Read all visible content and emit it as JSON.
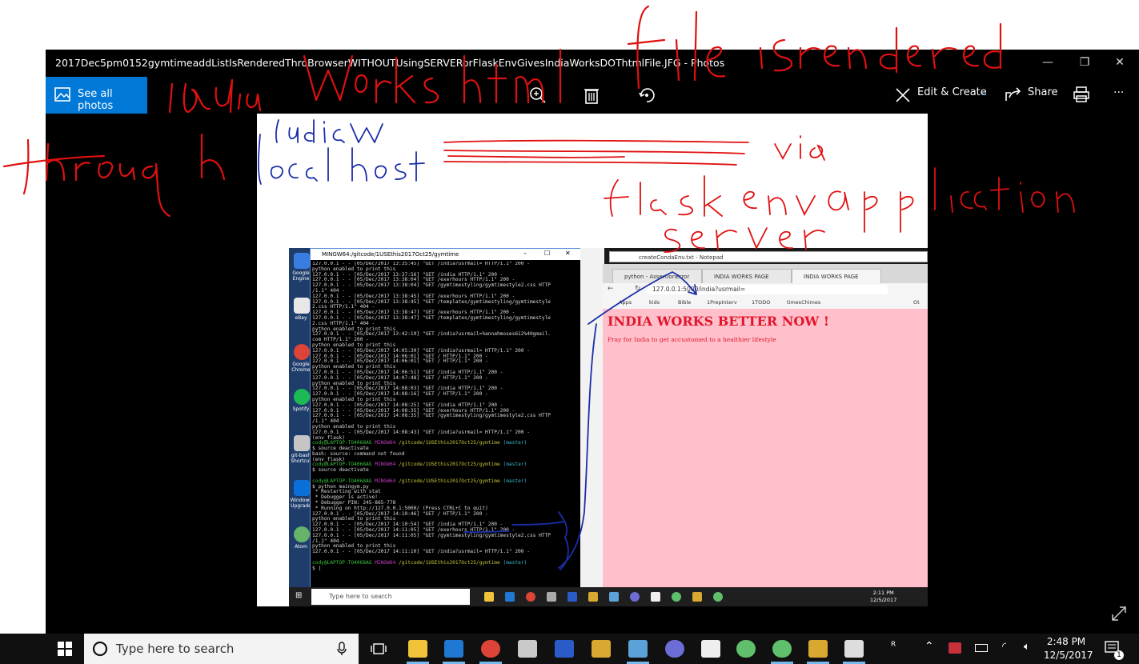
{
  "window": {
    "title": "2017Dec5pm0152gymtimeaddListIsRenderedThroBrowserWITHOUTUsingSERVERorFlaskEnvGivesIndiaWorksDOThtmlFile.JFG - Photos",
    "minimize": "—",
    "maximize": "❐",
    "close": "✕"
  },
  "toolbar": {
    "see_all_photos": "See all photos",
    "edit_create": "Edit & Create",
    "share": "Share",
    "more": "···",
    "accent": "#0078d7"
  },
  "inner": {
    "desktop_icons": [
      "Google Engine",
      "eBay",
      "Google Chrome",
      "Spotify",
      "git-bash Shortcut",
      "Windows Upgrade",
      "Atom"
    ],
    "terminal": {
      "title": "MINGW64:/gitcode/1USEthis2017Oct25/gymtime",
      "minimize": "–",
      "maximize": "☐",
      "close": "✕"
    },
    "notepad_title": "createCondaEnv.txt - Notepad",
    "chrome": {
      "tabs": [
        "python - AssertionError",
        "INDIA WORKS PAGE",
        "INDIA WORKS PAGE"
      ],
      "url": "127.0.0.1:5000/india?usrmail=",
      "bookmarks": [
        "Apps",
        "kids",
        "Bible",
        "1PrepInterv",
        "1TODO",
        "timesChimes",
        "Ot"
      ],
      "page_heading": "INDIA WORKS BETTER NOW !",
      "page_text": "Pray for India to get accustomed to a healthier lifestyle",
      "page_bg": "#ffc0cb",
      "page_fg": "#e0162b"
    },
    "taskbar": {
      "search_placeholder": "Type here to search",
      "time": "2:11 PM",
      "date": "12/5/2017"
    }
  },
  "taskbar": {
    "search_placeholder": "Type here to search",
    "time": "2:48 PM",
    "date": "12/5/2017",
    "notification_count": "1"
  }
}
